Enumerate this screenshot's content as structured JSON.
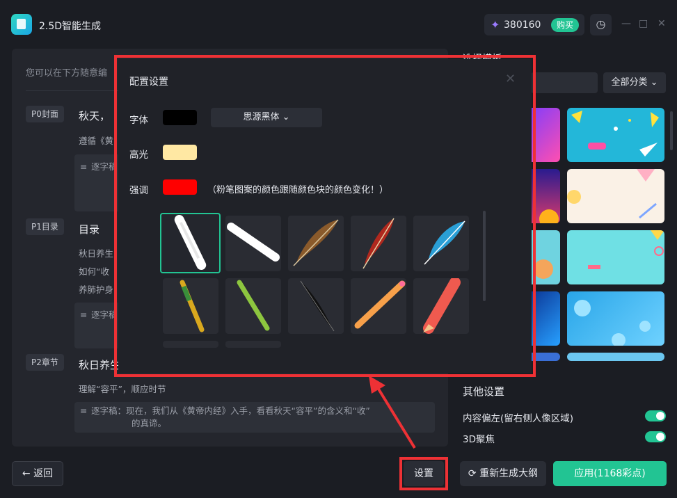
{
  "app": {
    "title": "2.5D智能生成"
  },
  "header": {
    "credits": "380160",
    "buy_label": "购买",
    "history_icon": "history-icon",
    "min": "—",
    "max": "□",
    "close": "✕"
  },
  "outline": {
    "hint": "您可以在下方随意编",
    "sections": [
      {
        "tag": "P0封面",
        "title": "秋天，",
        "lines": [
          "遵循《黄"
        ],
        "script": "逐字稿"
      },
      {
        "tag": "P1目录",
        "title": "目录",
        "lines": [
          "秋日养生",
          "如何“收",
          "养肺护身"
        ],
        "script": "逐字稿"
      },
      {
        "tag": "P2章节",
        "title": "秋日养生",
        "lines": [
          "理解“容平”，顺应时节"
        ],
        "script": "逐字稿：现在，我们从《黄帝内经》入手，看看秋天“容平”的含义和“收”",
        "script2": "的真谛。"
      }
    ]
  },
  "templates": {
    "heading": "选择模板",
    "category_label": "全部分类"
  },
  "other_settings": {
    "title": "其他设置",
    "options": [
      {
        "label": "内容偏左(留右侧人像区域)",
        "on": true
      },
      {
        "label": "3D聚焦",
        "on": true
      }
    ]
  },
  "footer": {
    "back_label": "返回",
    "settings_label": "设置",
    "regen_label": "重新生成大纲",
    "apply_label": "应用(1168彩点)"
  },
  "config_modal": {
    "title": "配置设置",
    "close_glyph": "✕",
    "font_label": "字体",
    "font_color": "#000000",
    "font_name": "思源黑体",
    "highlight_label": "高光",
    "highlight_color": "#ffe8a3",
    "emphasis_label": "强调",
    "emphasis_color": "#ff0000",
    "emphasis_note": "（粉笔图案的颜色跟随颜色块的颜色变化！）",
    "brushes": [
      "white-chalk",
      "white-chalk-flat",
      "brown-feather",
      "red-feather",
      "blue-feather",
      "striped-pencil",
      "green-pencil",
      "black-feather",
      "orange-pencil",
      "red-pencil"
    ]
  },
  "colors": {
    "accent": "#22c493",
    "annotation": "#ee3135"
  }
}
